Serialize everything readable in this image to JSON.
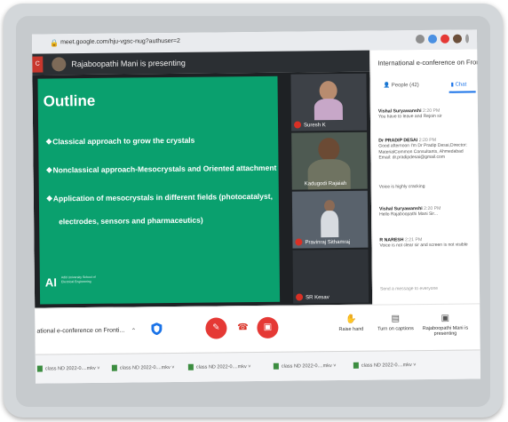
{
  "browser": {
    "url": "meet.google.com/hju-vgsc-nug?authuser=2"
  },
  "meeting": {
    "badge": "C",
    "presenting_banner": "Rajaboopathi Mani is presenting",
    "title": "International e-conference on Fronti..."
  },
  "slide": {
    "heading": "Outline",
    "bullets": [
      "Classical approach to grow the crystals",
      "Nonclassical approach-Mesocrystals and Oriented attachment",
      "Application of mesocrystals in different fields (photocatalyst,"
    ],
    "bullet3_cont": "electrodes, sensors and pharmaceutics)",
    "logo": "AI",
    "logo_text": "Aditi University School of Electrical Engineering"
  },
  "participants": [
    {
      "name": "Suresh K"
    },
    {
      "name": "Kadugodi Rajaiah"
    },
    {
      "name": "Pravinraj Sithamraj"
    },
    {
      "name": "SR Kesav"
    }
  ],
  "panel": {
    "title": "International e-conference on Front",
    "tab_people": "People (42)",
    "tab_chat": "Chat",
    "messages": [
      {
        "who": "Vishal Suryawanshi",
        "time": "2:20 PM",
        "text": "You have to leave and Rejoin sir"
      },
      {
        "who": "Dr PRADIP DESAI",
        "time": "2:20 PM",
        "text": "Good afternoon I'm Dr Pradip Desai,Director: MaterialCommon Consultants, Ahmedabad Email: dr.pradipdesai@gmail.com"
      },
      {
        "who": "",
        "time": "",
        "text": "Voice is highly cracking"
      },
      {
        "who": "Vishal Suryawanshi",
        "time": "2:20 PM",
        "text": "Hello Rajaboopathi Mani Sir..."
      },
      {
        "who": "R NARESH",
        "time": "2:21 PM",
        "text": "Voice is not clear sir and screen is not visible"
      }
    ],
    "send_placeholder": "Send a message to everyone"
  },
  "controls": {
    "conf_label": "ational e-conference on Fronti...",
    "raise_hand": "Raise hand",
    "captions": "Turn on captions",
    "presenting": "Rajaboopathi Mani is presenting"
  },
  "downloads": [
    "class ND 2022-0....mkv",
    "class ND 2022-0....mkv",
    "class ND 2022-0....mkv",
    "class ND 2022-0....mkv",
    "class ND 2022-0....mkv"
  ],
  "colors": {
    "slide_green": "#0aa06e",
    "meet_dark": "#2b2f33",
    "danger_red": "#e53935",
    "chat_blue": "#1a73e8"
  }
}
